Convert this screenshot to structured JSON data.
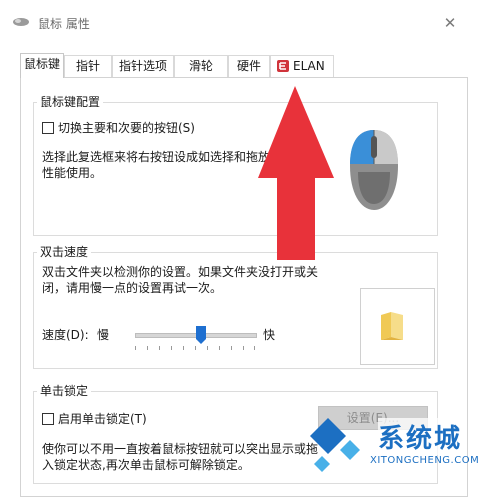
{
  "window": {
    "title": "鼠标 属性",
    "close_glyph": "✕"
  },
  "tabs": [
    {
      "label": "鼠标键",
      "active": true
    },
    {
      "label": "指针"
    },
    {
      "label": "指针选项"
    },
    {
      "label": "滑轮"
    },
    {
      "label": "硬件"
    },
    {
      "label": "ELAN",
      "icon": "elan-logo-icon"
    }
  ],
  "button_config": {
    "group_title": "鼠标键配置",
    "switch_label": "切换主要和次要的按钮(S)",
    "switch_checked": false,
    "description_line1": "选择此复选框来将右按钮设成如选择和拖放",
    "description_line2": "性能使用。"
  },
  "double_click": {
    "group_title": "双击速度",
    "description_line1": "双击文件夹以检测你的设置。如果文件夹没打开或关",
    "description_line2": "闭，请用慢一点的设置再试一次。",
    "speed_label": "速度(D):",
    "slow_label": "慢",
    "fast_label": "快",
    "speed_fraction": 0.55
  },
  "click_lock": {
    "group_title": "单击锁定",
    "enable_label": "启用单击锁定(T)",
    "enable_checked": false,
    "settings_button": "设置(E)...",
    "description_line1": "使你可以不用一直按着鼠标按钮就可以突出显示或拖",
    "description_line2": "入锁定状态,再次单击鼠标可解除锁定。"
  },
  "watermark": {
    "text": "系统城",
    "url": "XITONGCHENG.COM"
  },
  "colors": {
    "arrow": "#e8323a",
    "mouse_highlight": "#3a8fd8",
    "watermark": "#1c6fc2"
  }
}
